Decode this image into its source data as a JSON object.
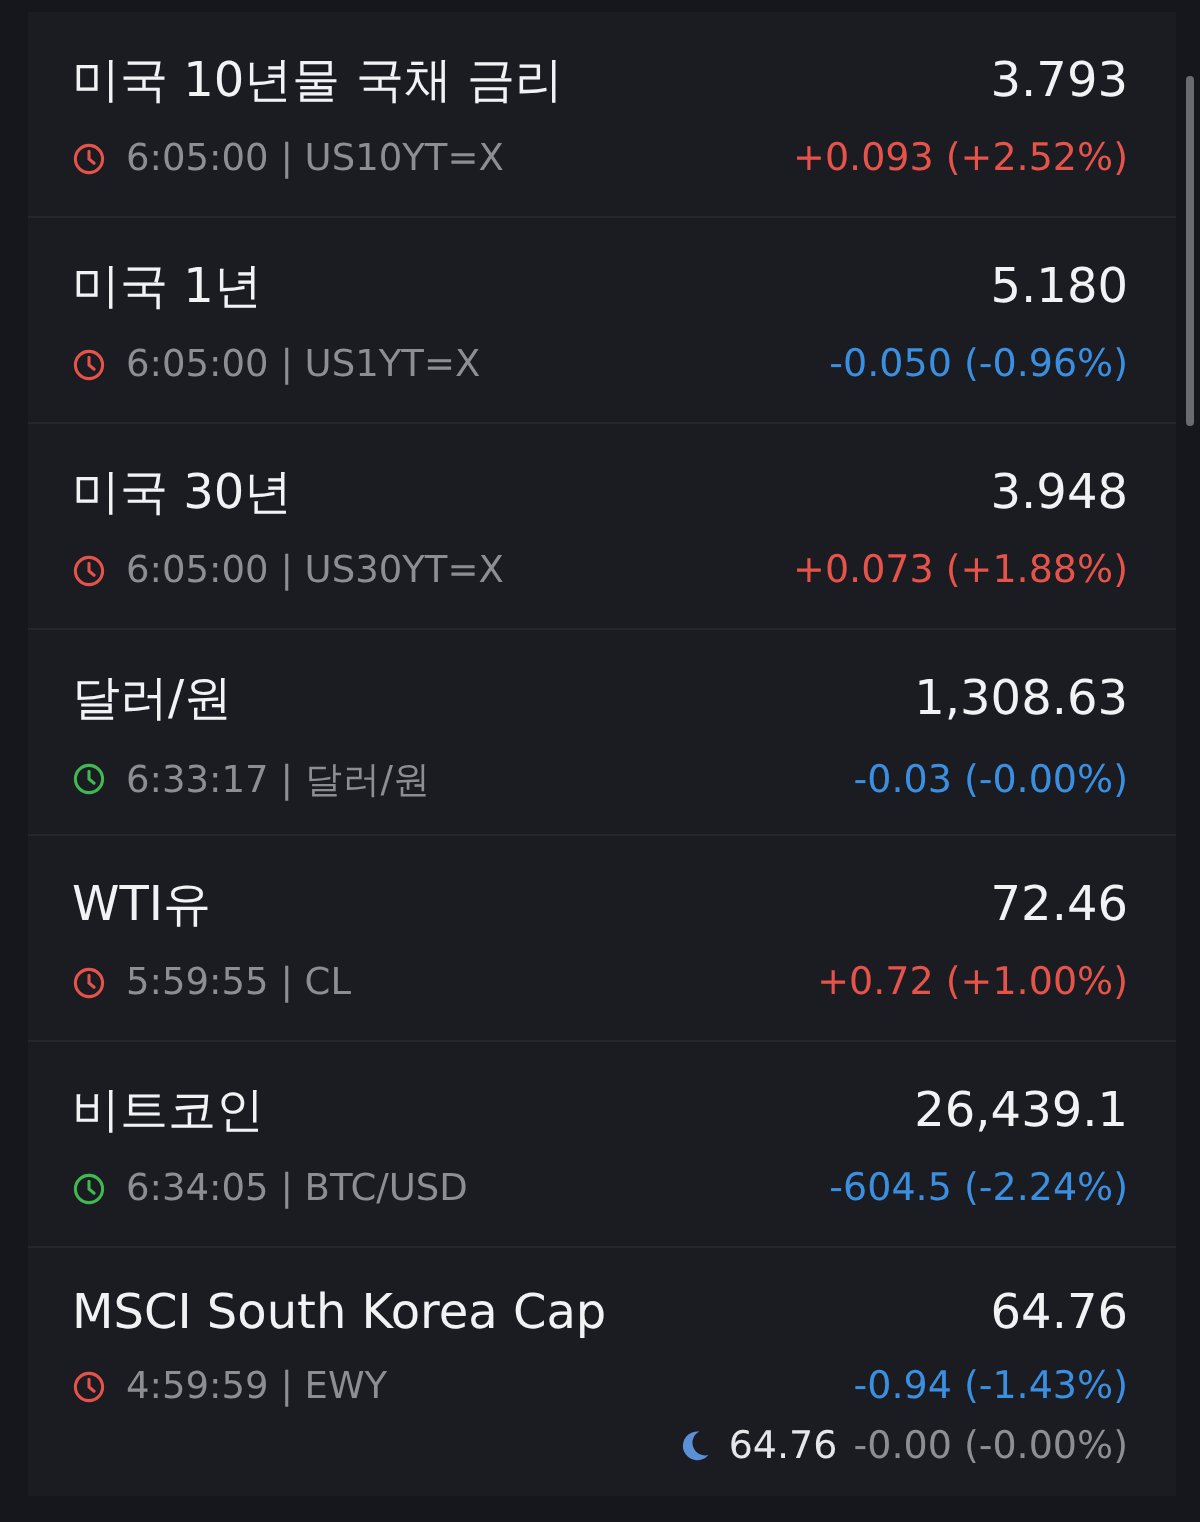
{
  "quotes": [
    {
      "name": "미국 10년물 국채 금리",
      "price": "3.793",
      "market_open": false,
      "meta": "6:05:00 | US10YT=X",
      "change": "+0.093 (+2.52%)",
      "color": "#e5534b"
    },
    {
      "name": "미국 1년",
      "price": "5.180",
      "market_open": false,
      "meta": "6:05:00 | US1YT=X",
      "change": "-0.050 (-0.96%)",
      "color": "#3b8fe0"
    },
    {
      "name": "미국 30년",
      "price": "3.948",
      "market_open": false,
      "meta": "6:05:00 | US30YT=X",
      "change": "+0.073 (+1.88%)",
      "color": "#e5534b"
    },
    {
      "name": "달러/원",
      "price": "1,308.63",
      "market_open": true,
      "meta": "6:33:17 | 달러/원",
      "change": "-0.03 (-0.00%)",
      "color": "#3b8fe0"
    },
    {
      "name": "WTI유",
      "price": "72.46",
      "market_open": false,
      "meta": "5:59:55 | CL",
      "change": "+0.72 (+1.00%)",
      "color": "#e5534b"
    },
    {
      "name": "비트코인",
      "price": "26,439.1",
      "market_open": true,
      "meta": "6:34:05 | BTC/USD",
      "change": "-604.5 (-2.24%)",
      "color": "#3b8fe0"
    },
    {
      "name": "MSCI South Korea Cap",
      "price": "64.76",
      "market_open": false,
      "meta": "4:59:59 | EWY",
      "change": "-0.94 (-1.43%)",
      "color": "#3b8fe0",
      "after_hours": {
        "price": "64.76",
        "change": "-0.00 (-0.00%)"
      }
    }
  ]
}
